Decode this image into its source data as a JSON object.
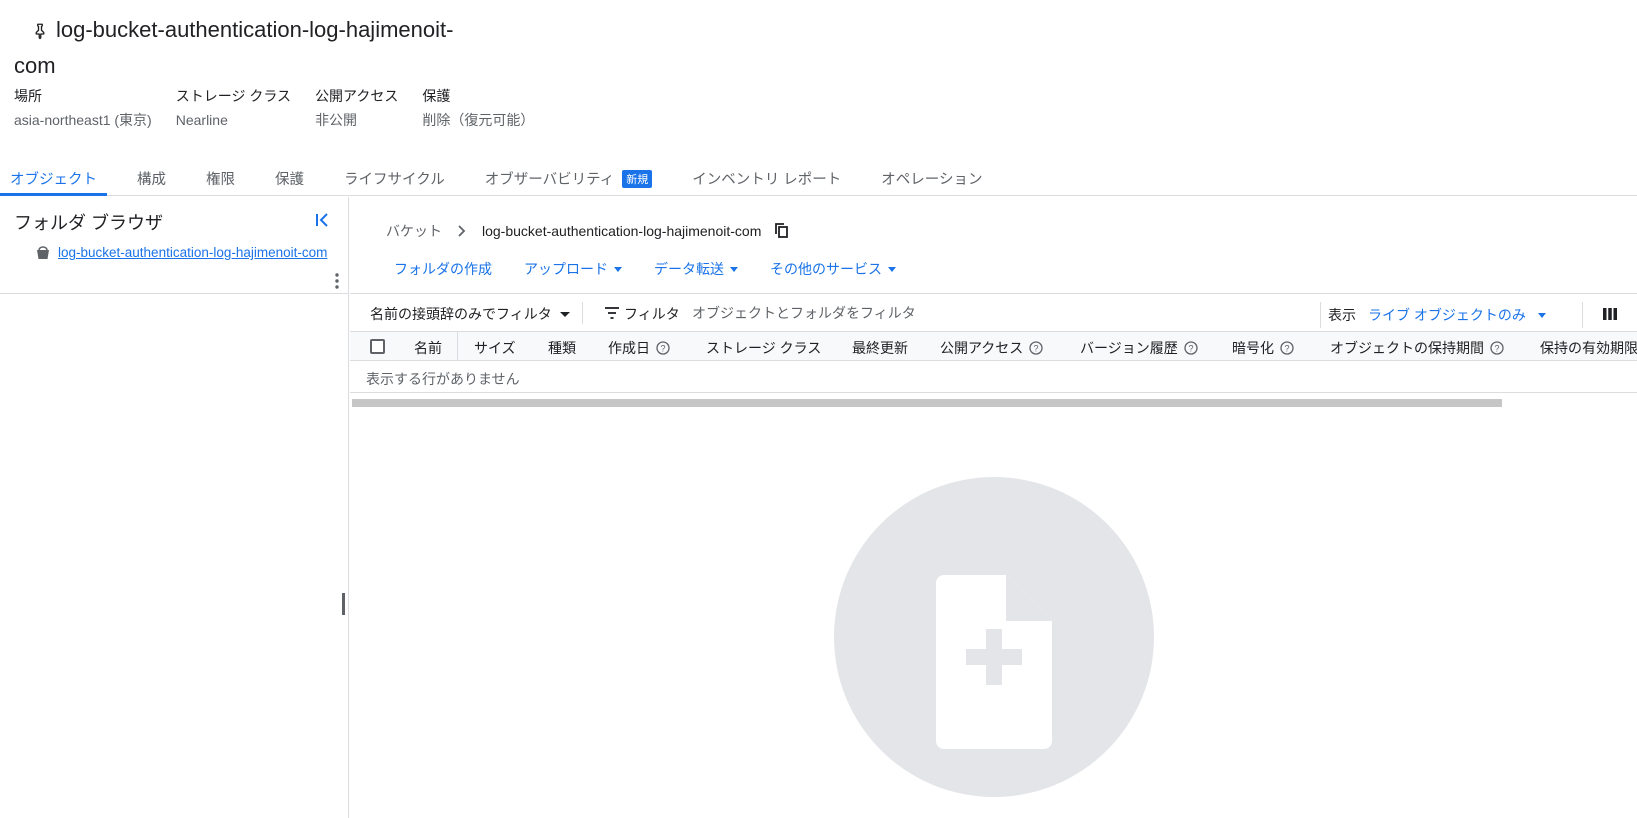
{
  "bucket": {
    "title": "log-bucket-authentication-log-hajimenoit-com",
    "meta": [
      {
        "label": "場所",
        "value": "asia-northeast1 (東京)"
      },
      {
        "label": "ストレージ クラス",
        "value": "Nearline"
      },
      {
        "label": "公開アクセス",
        "value": "非公開"
      },
      {
        "label": "保護",
        "value": "削除（復元可能）"
      }
    ]
  },
  "tabs": [
    {
      "label": "オブジェクト",
      "active": true
    },
    {
      "label": "構成"
    },
    {
      "label": "権限"
    },
    {
      "label": "保護"
    },
    {
      "label": "ライフサイクル"
    },
    {
      "label": "オブザーバビリティ",
      "badge": "新規"
    },
    {
      "label": "インベントリ レポート"
    },
    {
      "label": "オペレーション"
    }
  ],
  "folder_browser": {
    "title": "フォルダ ブラウザ",
    "bucket_link": "log-bucket-authentication-log-hajimenoit-com"
  },
  "breadcrumb": {
    "root": "バケット",
    "current": "log-bucket-authentication-log-hajimenoit-com"
  },
  "actions": {
    "create_folder": "フォルダの作成",
    "upload": "アップロード",
    "transfer": "データ転送",
    "other": "その他のサービス"
  },
  "toolbar": {
    "prefix_filter": "名前の接頭辞のみでフィルタ",
    "filter_label": "フィルタ",
    "filter_placeholder": "オブジェクトとフォルダをフィルタ",
    "show_label": "表示",
    "show_value": "ライブ オブジェクトのみ"
  },
  "table": {
    "columns": [
      "名前",
      "サイズ",
      "種類",
      "作成日",
      "ストレージ クラス",
      "最終更新",
      "公開アクセス",
      "バージョン履歴",
      "暗号化",
      "オブジェクトの保持期間",
      "保持の有効期限"
    ],
    "empty_text": "表示する行がありません"
  },
  "colors": {
    "accent": "#1a73e8",
    "text": "#202124",
    "muted": "#5f6368",
    "divider": "#dadce0",
    "illustration_bg": "#e3e5e8"
  }
}
